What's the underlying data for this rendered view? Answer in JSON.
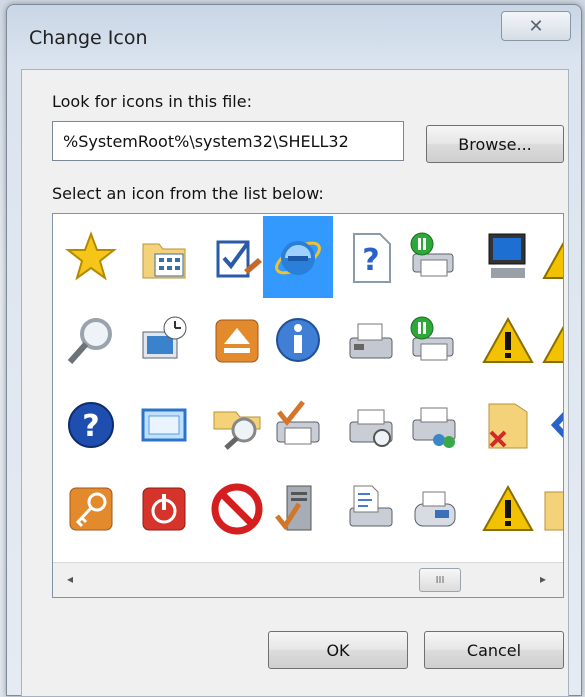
{
  "dialog": {
    "title": "Change Icon",
    "close_glyph": "✕"
  },
  "look_for_label": "Look for icons in this file:",
  "file_path": "%SystemRoot%\\system32\\SHELL32",
  "browse_label": "Browse...",
  "select_label": "Select an icon from the list below:",
  "icons": [
    [
      "star-icon",
      "control-panel-folder-icon",
      "checklist-icon",
      "internet-explorer-icon",
      "help-document-icon",
      "printer-paused-icon",
      "computer-monitor-icon",
      "warning-icon"
    ],
    [
      "magnifier-icon",
      "desktop-clock-icon",
      "eject-icon",
      "info-icon",
      "fax-printer-icon",
      "printer-paused-icon",
      "warning-icon",
      "warning-icon"
    ],
    [
      "help-icon",
      "screen-icon",
      "search-folder-icon",
      "printer-check-icon",
      "printer-search-icon",
      "printer-network-icon",
      "folder-delete-icon",
      "arrow-icon"
    ],
    [
      "key-icon",
      "power-icon",
      "blocked-icon",
      "server-check-icon",
      "printer-document-icon",
      "fax-icon",
      "warning-icon",
      "folder-icon"
    ]
  ],
  "selected_icon": {
    "row": 0,
    "col": 3
  },
  "scrollbar": {
    "left_arrow": "◂",
    "right_arrow": "▸",
    "thumb_grip": "III"
  },
  "ok_label": "OK",
  "cancel_label": "Cancel"
}
